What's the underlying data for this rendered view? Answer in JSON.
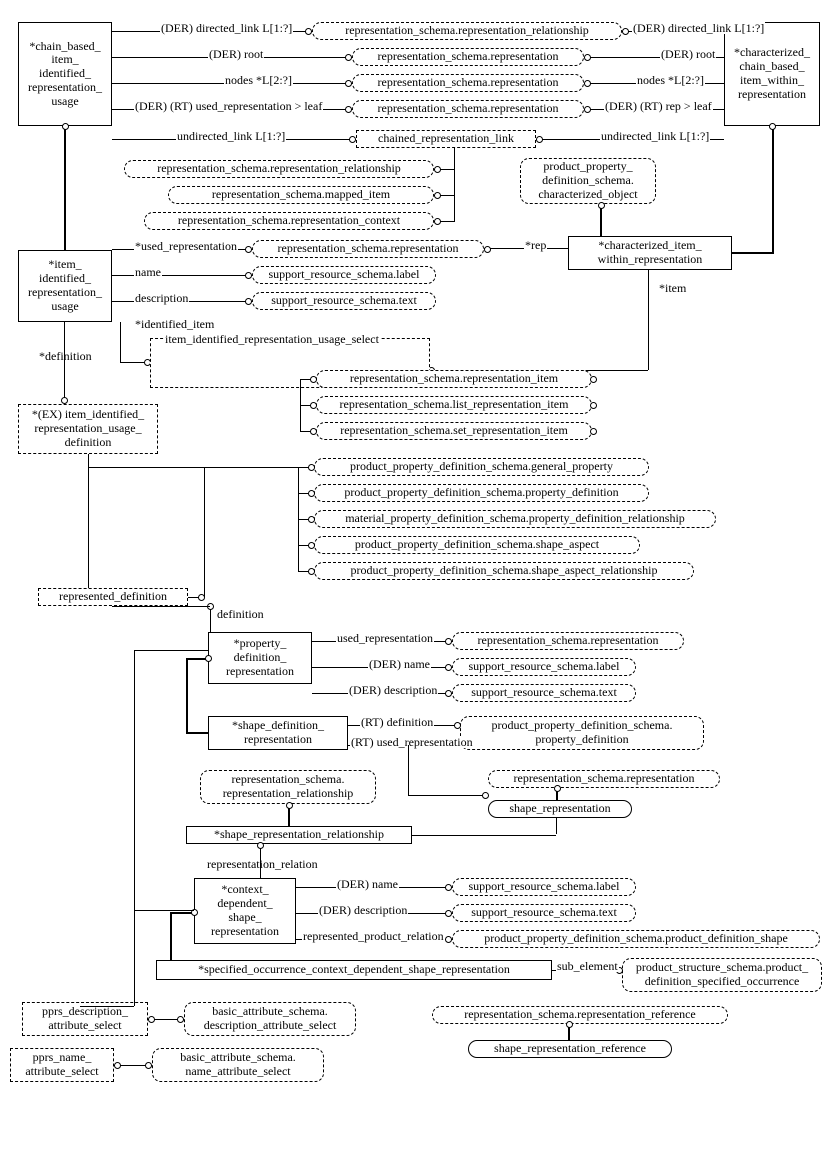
{
  "ent": {
    "chain_usage": "*chain_based_\nitem_\nidentified_\nrepresentation_\nusage",
    "char_chain": "*characterized_\nchain_based_\nitem_within_\nrepresentation",
    "item_usage": "*item_\nidentified_\nrepresentation_\nusage",
    "char_item": "*characterized_item_\nwithin_representation",
    "ex_def": "*(EX) item_identified_\nrepresentation_usage_\ndefinition",
    "item_sel": "item_identified_representation_usage_select",
    "repr_def": "represented_definition",
    "chained_link": "chained_representation_link",
    "pdr": "*property_\ndefinition_\nrepresentation",
    "sdr": "*shape_definition_\nrepresentation",
    "rsrr_box": "representation_schema.\nrepresentation_relationship",
    "srr": "*shape_representation_relationship",
    "cdsr": "*context_\ndependent_\nshape_\nrepresentation",
    "socdsr": "*specified_occurrence_context_dependent_shape_representation",
    "pds_attr": "pprs_description_\nattribute_select",
    "pns_attr": "pprs_name_\nattribute_select"
  },
  "pill": {
    "rsrr": "representation_schema.representation_relationship",
    "rsr": "representation_schema.representation",
    "rsmi": "representation_schema.mapped_item",
    "rsrc": "representation_schema.representation_context",
    "char_obj": "product_property_\ndefinition_schema.\ncharacterized_object",
    "srs_label": "support_resource_schema.label",
    "srs_text": "support_resource_schema.text",
    "rsri": "representation_schema.representation_item",
    "rslri": "representation_schema.list_representation_item",
    "rssri": "representation_schema.set_representation_item",
    "ppds_gp": "product_property_definition_schema.general_property",
    "ppds_pd": "product_property_definition_schema.property_definition",
    "mpds_pdr": "material_property_definition_schema.property_definition_relationship",
    "ppds_sa": "product_property_definition_schema.shape_aspect",
    "ppds_sar": "product_property_definition_schema.shape_aspect_relationship",
    "ppds_pd2": "product_property_definition_schema.\nproperty_definition",
    "shape_rep": "shape_representation",
    "ppds_pds": "product_property_definition_schema.product_definition_shape",
    "pss_pdso": "product_structure_schema.product_\ndefinition_specified_occurrence",
    "bas_desc": "basic_attribute_schema.\ndescription_attribute_select",
    "bas_name": "basic_attribute_schema.\nname_attribute_select",
    "rsrr_ref": "representation_schema.representation_reference",
    "srr_ref": "shape_representation_reference"
  },
  "lbl": {
    "der_dl_l": "(DER) directed_link L[1:?]",
    "der_dl_r": "(DER) directed_link L[1:?]",
    "der_root_l": "(DER) root",
    "der_root_r": "(DER) root",
    "nodes_l": "nodes *L[2:?]",
    "nodes_r": "nodes *L[2:?]",
    "used_leaf": "(DER) (RT) used_representation > leaf",
    "rep_leaf": "(DER) (RT) rep > leaf",
    "undir_l": "undirected_link L[1:?]",
    "undir_r": "undirected_link L[1:?]",
    "rep_attr": "*rep",
    "used_rep": "*used_representation",
    "name": "name",
    "desc": "description",
    "id_item": "*identified_item",
    "definition": "*definition",
    "item_attr": "*item",
    "pdr_def": "definition",
    "pdr_used": "used_representation",
    "pdr_name": "(DER) name",
    "pdr_desc": "(DER) description",
    "rt_def": "(RT) definition",
    "rt_used": "(RT) used_representation",
    "rep_rel": "representation_relation",
    "c_name": "(DER) name",
    "c_desc": "(DER) description",
    "c_rpr": "represented_product_relation",
    "sub_el": "sub_element"
  }
}
